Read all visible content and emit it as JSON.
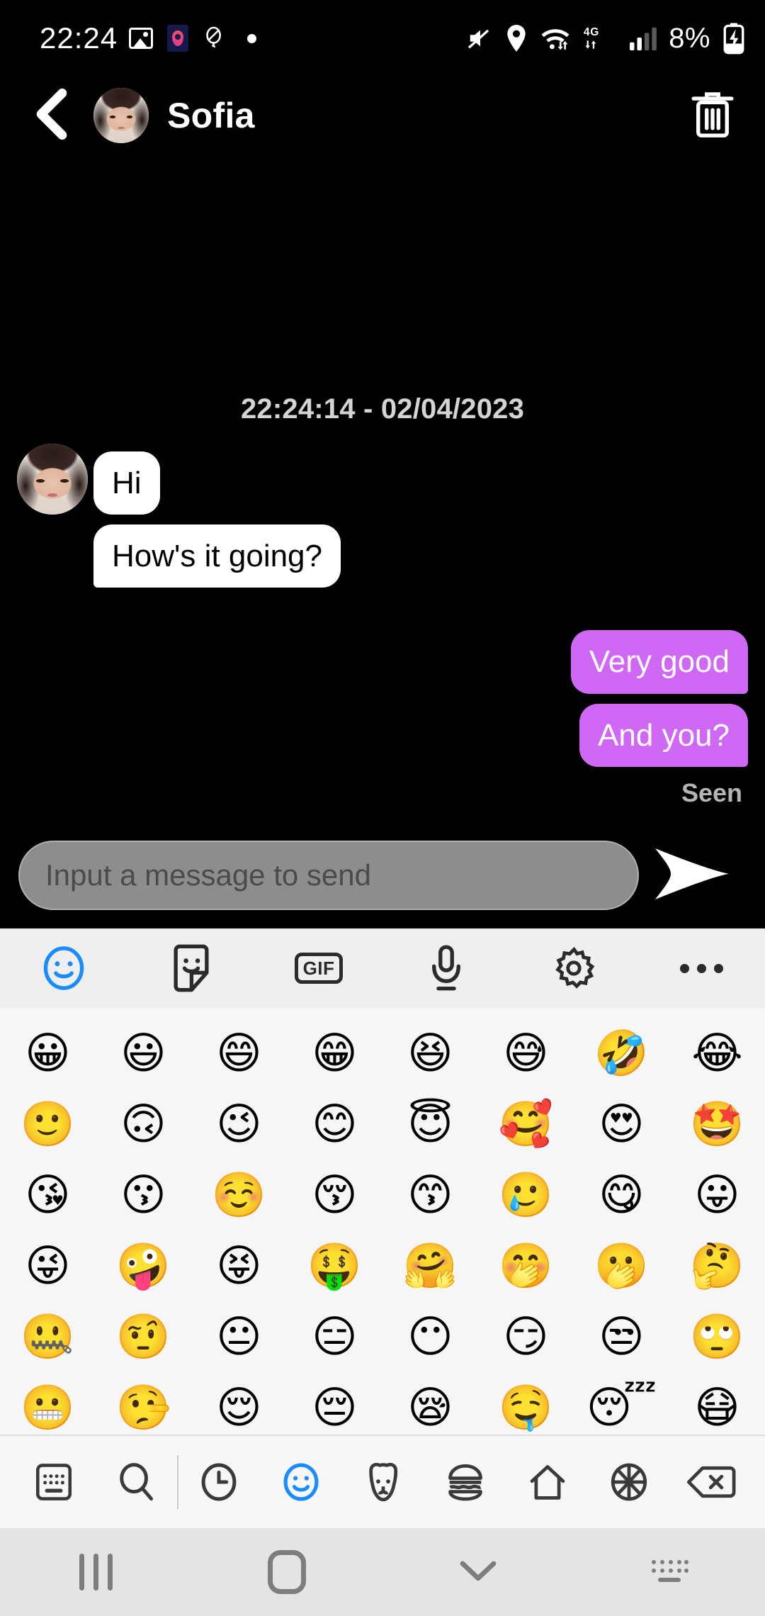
{
  "status_bar": {
    "clock": "22:24",
    "battery_percent": "8%",
    "network_type": "4G",
    "left_icons": [
      "gallery-icon",
      "maps-icon",
      "balloon-icon",
      "dot-icon"
    ],
    "right_icons": [
      "mute-icon",
      "location-icon",
      "wifi-icon",
      "mobile-signal-icon",
      "battery-charging-icon"
    ]
  },
  "chat_header": {
    "back_icon": "back-chevron-icon",
    "contact_name": "Sofia",
    "delete_icon": "trash-icon"
  },
  "conversation": {
    "timestamp": "22:24:14 - 02/04/2023",
    "messages": [
      {
        "side": "in",
        "text": "Hi",
        "show_avatar": true
      },
      {
        "side": "in",
        "text": "How's it going?",
        "show_avatar": false
      },
      {
        "side": "out",
        "text": "Very good"
      },
      {
        "side": "out",
        "text": "And you?"
      }
    ],
    "read_receipt": "Seen"
  },
  "composer": {
    "placeholder": "Input a message to send",
    "value": "",
    "send_icon": "send-paper-plane-icon"
  },
  "emoji_keyboard": {
    "toolbar": [
      {
        "name": "emoji-tab-icon",
        "label": "Emoji",
        "active": true
      },
      {
        "name": "sticker-tab-icon",
        "label": "Stickers",
        "active": false
      },
      {
        "name": "gif-tab-icon",
        "label": "GIF",
        "active": false
      },
      {
        "name": "mic-tab-icon",
        "label": "Voice",
        "active": false
      },
      {
        "name": "settings-tab-icon",
        "label": "Settings",
        "active": false
      },
      {
        "name": "more-tab-icon",
        "label": "More",
        "active": false
      }
    ],
    "gif_label": "GIF",
    "rows": [
      [
        "😀",
        "😃",
        "😄",
        "😁",
        "😆",
        "😅",
        "🤣",
        "😂"
      ],
      [
        "🙂",
        "🙃",
        "😉",
        "😊",
        "😇",
        "🥰",
        "😍",
        "🤩"
      ],
      [
        "😘",
        "😗",
        "☺️",
        "😚",
        "😙",
        "🥲",
        "😋",
        "😛"
      ],
      [
        "😜",
        "🤪",
        "😝",
        "🤑",
        "🤗",
        "🤭",
        "🫢",
        "🤔"
      ],
      [
        "🤐",
        "🤨",
        "😐",
        "😑",
        "😶",
        "😏",
        "😒",
        "🙄"
      ],
      [
        "😬",
        "🤥",
        "😌",
        "😔",
        "😪",
        "🤤",
        "😴",
        "😷"
      ]
    ],
    "categories": [
      {
        "name": "keyboard-switch-icon",
        "label": "Keyboard",
        "active": false
      },
      {
        "name": "search-icon",
        "label": "Search",
        "active": false
      },
      {
        "name": "recent-clock-icon",
        "label": "Recent",
        "active": false
      },
      {
        "name": "smileys-icon",
        "label": "Smileys",
        "active": true
      },
      {
        "name": "animals-icon",
        "label": "Animals",
        "active": false
      },
      {
        "name": "food-icon",
        "label": "Food",
        "active": false
      },
      {
        "name": "travel-icon",
        "label": "Travel",
        "active": false
      },
      {
        "name": "activities-icon",
        "label": "Activities",
        "active": false
      },
      {
        "name": "backspace-icon",
        "label": "Backspace",
        "active": false
      }
    ]
  },
  "android_nav": {
    "buttons": [
      {
        "name": "recents-button",
        "label": "Recents"
      },
      {
        "name": "home-button",
        "label": "Home"
      },
      {
        "name": "hide-keyboard-button",
        "label": "Hide keyboard"
      },
      {
        "name": "keyboard-layout-button",
        "label": "Keyboard layout"
      }
    ]
  },
  "colors": {
    "background": "#000000",
    "incoming_bubble": "#ffffff",
    "outgoing_bubble": "#cf68f5",
    "accent_blue": "#1a8cff",
    "keyboard_bg": "#f6f6f6",
    "nav_bg": "#e4e4e4"
  }
}
